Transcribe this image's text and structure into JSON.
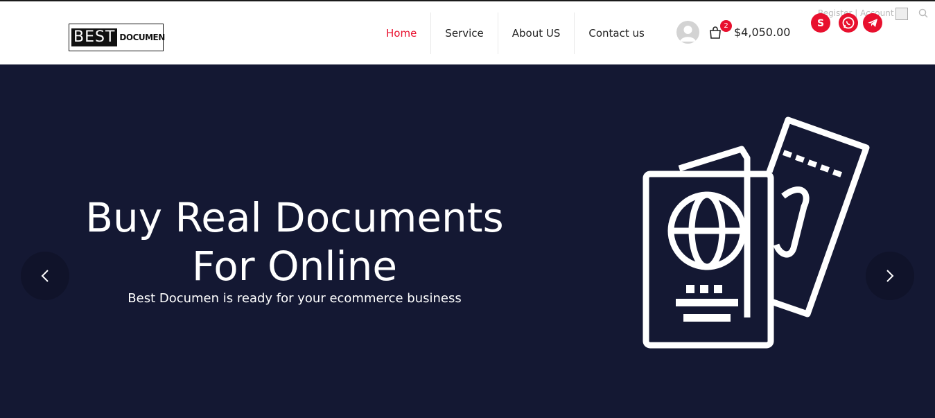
{
  "brand": {
    "logo_word1": "BEST",
    "logo_word2": "DOCUMEN"
  },
  "nav": {
    "items": [
      {
        "label": "Home",
        "active": true
      },
      {
        "label": "Service",
        "active": false
      },
      {
        "label": "About US",
        "active": false
      },
      {
        "label": "Contact us",
        "active": false
      }
    ]
  },
  "cart": {
    "count": "2",
    "total": "$4,050.00"
  },
  "topbar": {
    "account_text": "Register | Account"
  },
  "social": [
    "skype-icon",
    "whatsapp-icon",
    "telegram-icon"
  ],
  "hero": {
    "title_line1": "Buy Real Documents",
    "title_line2": "For Online",
    "subtitle": "Best Documen is ready for your ecommerce business"
  },
  "colors": {
    "accent": "#e8102e",
    "hero_bg": "#141833"
  }
}
